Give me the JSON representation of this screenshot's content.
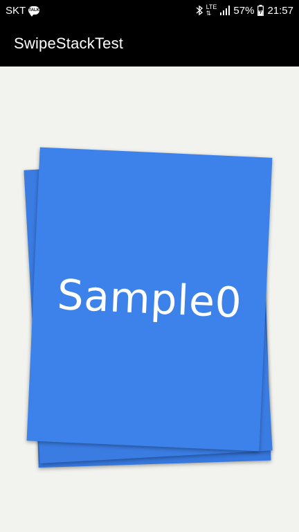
{
  "status_bar": {
    "carrier": "SKT",
    "chat_badge": "TALK",
    "network": "LTE",
    "battery": "57%",
    "time": "21:57"
  },
  "app_bar": {
    "title": "SwipeStackTest"
  },
  "swipe_stack": {
    "top_card_label": "Sample0",
    "card_color": "#3d82ea"
  }
}
